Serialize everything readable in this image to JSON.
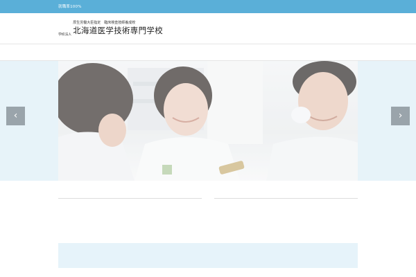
{
  "topbar": {
    "message": "就職率100%",
    "link": ""
  },
  "header": {
    "corp_line1": "学校法人",
    "corp_line2": "",
    "designation": "厚生労働大臣指定　臨床検査技師養成校",
    "school_name": "北海道医学技術専門学校"
  },
  "nav": {
    "items": [
      "",
      "",
      "",
      "",
      "",
      ""
    ]
  },
  "hero": {
    "prev_label": "‹",
    "next_label": "›"
  },
  "content": {
    "col1_title": "",
    "col1_text": "",
    "col2_title": "",
    "col2_text": "",
    "notice_small": "",
    "notice_big": ""
  },
  "colors": {
    "topbar": "#5aafd8",
    "accent_text": "#c88a1e",
    "notice_bg": "#e6f3fa"
  }
}
